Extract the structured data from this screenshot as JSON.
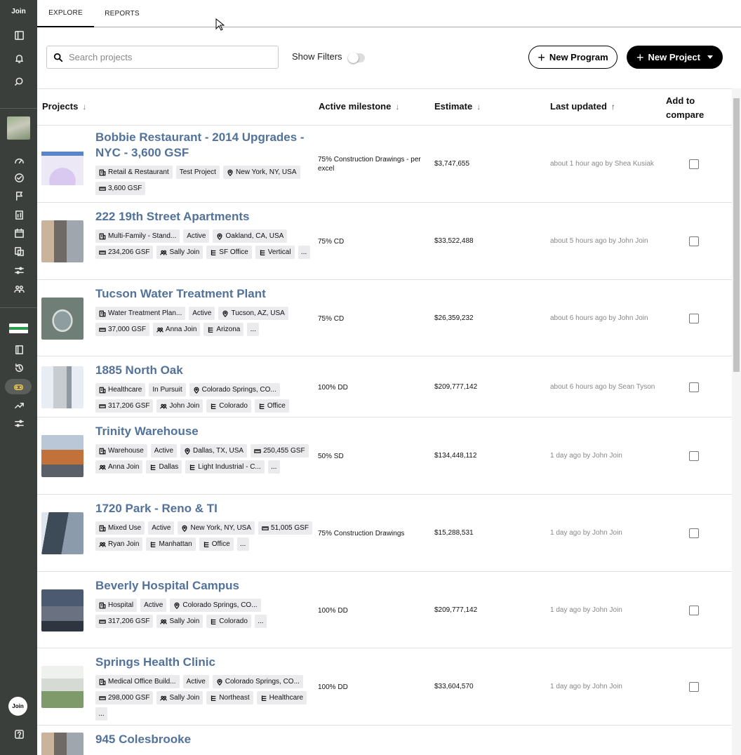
{
  "sidebar": {
    "brand": "Join",
    "avatar_text": "Join",
    "icons": [
      "sidebar-toggle-icon",
      "bell-icon",
      "search-icon",
      "project-thumbnail",
      "dashboard-icon",
      "check-circle-icon",
      "flag-icon",
      "report-icon",
      "calendar-icon",
      "document-icon",
      "sliders-icon",
      "team-icon",
      "company-logo",
      "book-icon",
      "history-icon",
      "controller-icon",
      "trend-icon",
      "settings-sliders-icon",
      "avatar",
      "help-icon"
    ]
  },
  "tabs": [
    {
      "label": "EXPLORE",
      "selected": true
    },
    {
      "label": "REPORTS",
      "selected": false
    }
  ],
  "toolbar": {
    "search_placeholder": "Search projects",
    "show_filters_label": "Show Filters",
    "new_program_label": "New Program",
    "new_project_label": "New Project"
  },
  "table": {
    "headers": {
      "projects": "Projects",
      "milestone": "Active milestone",
      "estimate": "Estimate",
      "updated": "Last updated",
      "compare": "Add to compare"
    },
    "rows": [
      {
        "name": "Bobbie Restaurant - 2014 Upgrades - NYC - 3,600 GSF",
        "chips": [
          {
            "icon": "building-icon",
            "text": "Retail & Restaurant"
          },
          {
            "icon": "",
            "text": "Test Project"
          },
          {
            "icon": "location-icon",
            "text": "New York, NY, USA"
          },
          {
            "icon": "ruler-icon",
            "text": "3,600 GSF"
          }
        ],
        "more": "",
        "milestone": "75% Construction Drawings - per excel",
        "estimate": "$3,747,655",
        "updated": "about 1 hour ago by Shea Kusiak",
        "thumb": "illustration"
      },
      {
        "name": "222 19th Street Apartments",
        "chips": [
          {
            "icon": "building-icon",
            "text": "Multi-Family - Stand..."
          },
          {
            "icon": "",
            "text": "Active"
          },
          {
            "icon": "location-icon",
            "text": "Oakland, CA, USA"
          },
          {
            "icon": "ruler-icon",
            "text": "234,206 GSF"
          },
          {
            "icon": "people-icon",
            "text": "Sally Join"
          },
          {
            "icon": "tree-icon",
            "text": "SF Office"
          },
          {
            "icon": "tree-icon",
            "text": "Vertical"
          }
        ],
        "more": "...",
        "milestone": "75% CD",
        "estimate": "$33,522,488",
        "updated": "about 5 hours ago by John Join",
        "thumb": "apartments"
      },
      {
        "name": "Tucson Water Treatment Plant",
        "chips": [
          {
            "icon": "building-icon",
            "text": "Water Treatment Plan..."
          },
          {
            "icon": "",
            "text": "Active"
          },
          {
            "icon": "location-icon",
            "text": "Tucson, AZ, USA"
          },
          {
            "icon": "ruler-icon",
            "text": "37,000 GSF"
          },
          {
            "icon": "people-icon",
            "text": "Anna Join"
          },
          {
            "icon": "tree-icon",
            "text": "Arizona"
          }
        ],
        "more": "...",
        "milestone": "75% CD",
        "estimate": "$26,359,232",
        "updated": "about 6 hours ago by John Join",
        "thumb": "water"
      },
      {
        "name": "1885 North Oak",
        "chips": [
          {
            "icon": "building-icon",
            "text": "Healthcare"
          },
          {
            "icon": "",
            "text": "In Pursuit"
          },
          {
            "icon": "location-icon",
            "text": "Colorado Springs, CO..."
          },
          {
            "icon": "ruler-icon",
            "text": "317,206 GSF"
          },
          {
            "icon": "people-icon",
            "text": "John Join"
          },
          {
            "icon": "tree-icon",
            "text": "Colorado"
          },
          {
            "icon": "tree-icon",
            "text": "Office"
          }
        ],
        "more": "",
        "milestone": "100% DD",
        "estimate": "$209,777,142",
        "updated": "about 6 hours ago by Sean Tyson",
        "thumb": "tower"
      },
      {
        "name": "Trinity Warehouse",
        "chips": [
          {
            "icon": "building-icon",
            "text": "Warehouse"
          },
          {
            "icon": "",
            "text": "Active"
          },
          {
            "icon": "location-icon",
            "text": "Dallas, TX, USA"
          },
          {
            "icon": "ruler-icon",
            "text": "250,455 GSF"
          },
          {
            "icon": "people-icon",
            "text": "Anna Join"
          },
          {
            "icon": "tree-icon",
            "text": "Dallas"
          },
          {
            "icon": "tree-icon",
            "text": "Light Industrial - C..."
          }
        ],
        "more": "...",
        "milestone": "50% SD",
        "estimate": "$134,448,112",
        "updated": "1 day ago by John Join",
        "thumb": "warehouse"
      },
      {
        "name": "1720 Park - Reno & TI",
        "chips": [
          {
            "icon": "building-icon",
            "text": "Mixed Use"
          },
          {
            "icon": "",
            "text": "Active"
          },
          {
            "icon": "location-icon",
            "text": "New York, NY, USA"
          },
          {
            "icon": "ruler-icon",
            "text": "51,005 GSF"
          },
          {
            "icon": "people-icon",
            "text": "Ryan Join"
          },
          {
            "icon": "tree-icon",
            "text": "Manhattan"
          },
          {
            "icon": "tree-icon",
            "text": "Office"
          }
        ],
        "more": "...",
        "milestone": "75% Construction Drawings",
        "estimate": "$15,288,531",
        "updated": "1 day ago by John Join",
        "thumb": "glass"
      },
      {
        "name": "Beverly Hospital Campus",
        "chips": [
          {
            "icon": "building-icon",
            "text": "Hospital"
          },
          {
            "icon": "",
            "text": "Active"
          },
          {
            "icon": "location-icon",
            "text": "Colorado Springs, CO..."
          },
          {
            "icon": "ruler-icon",
            "text": "317,206 GSF"
          },
          {
            "icon": "people-icon",
            "text": "Sally Join"
          },
          {
            "icon": "tree-icon",
            "text": "Colorado"
          }
        ],
        "more": "...",
        "milestone": "100% DD",
        "estimate": "$209,777,142",
        "updated": "1 day ago by John Join",
        "thumb": "hospital"
      },
      {
        "name": "Springs Health Clinic",
        "chips": [
          {
            "icon": "building-icon",
            "text": "Medical Office Build..."
          },
          {
            "icon": "",
            "text": "Active"
          },
          {
            "icon": "location-icon",
            "text": "Colorado Springs, CO..."
          },
          {
            "icon": "ruler-icon",
            "text": "298,000 GSF"
          },
          {
            "icon": "people-icon",
            "text": "Sally Join"
          },
          {
            "icon": "tree-icon",
            "text": "Northeast"
          },
          {
            "icon": "tree-icon",
            "text": "Healthcare"
          }
        ],
        "more": "...",
        "milestone": "100% DD",
        "estimate": "$33,604,570",
        "updated": "1 day ago by John Join",
        "thumb": "clinic"
      },
      {
        "name": "945 Colesbrooke",
        "chips": [],
        "more": "",
        "milestone": "",
        "estimate": "",
        "updated": "",
        "thumb": "apartments"
      }
    ]
  },
  "colors": {
    "sidebar_bg": "#3b3f3c",
    "project_link": "#52729b",
    "chip_bg": "#ebebed",
    "active_icon": "#f2c94c"
  }
}
